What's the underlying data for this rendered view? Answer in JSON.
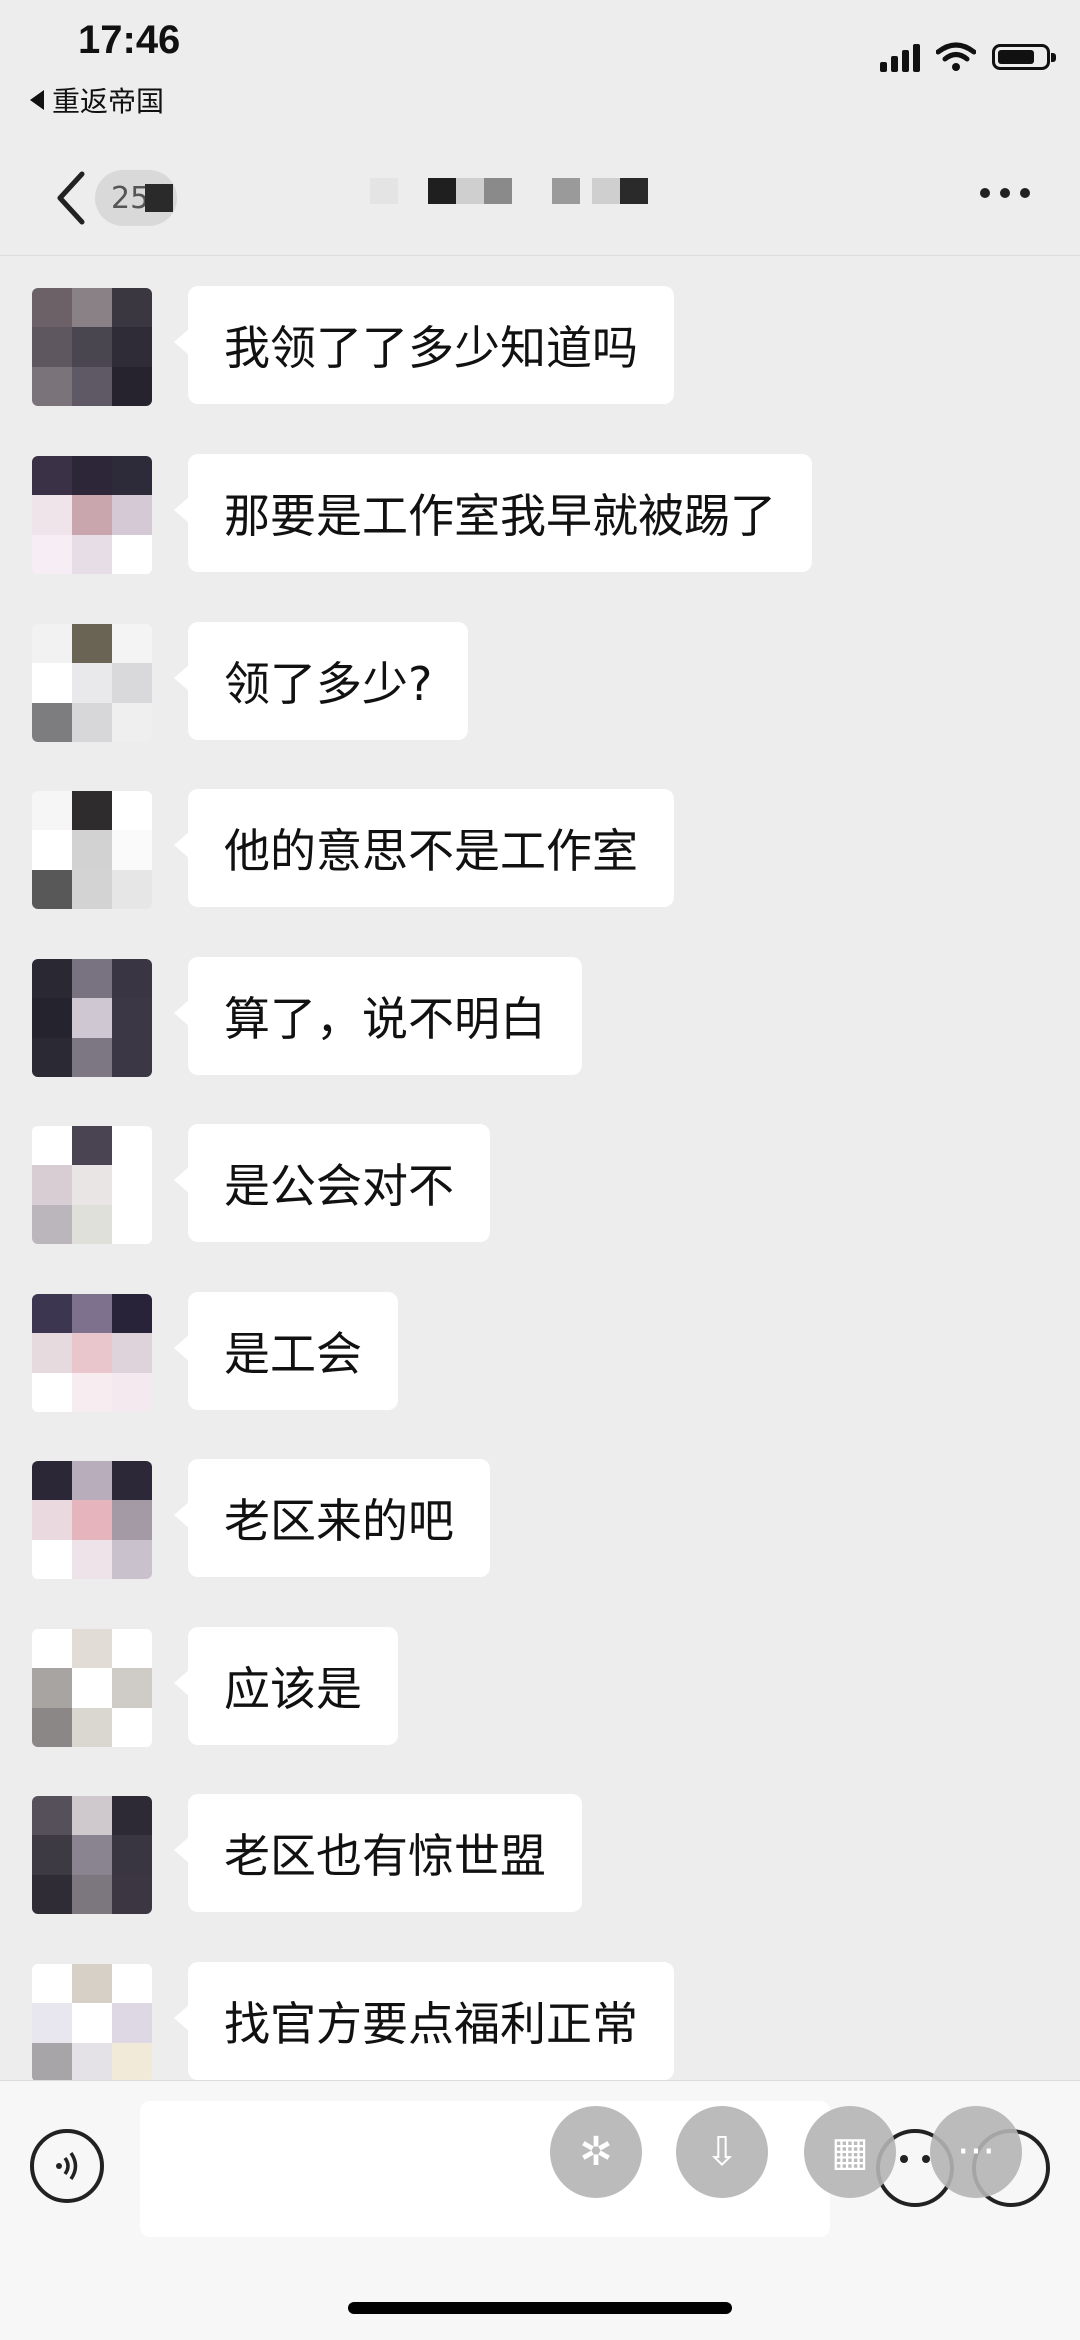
{
  "status_bar": {
    "time": "17:46",
    "back_app": "重返帝国"
  },
  "nav": {
    "unread_count": "25",
    "more_icon": "ellipsis-icon"
  },
  "messages": [
    {
      "text": "我领了了多少知道吗",
      "avatar_colors": [
        "#6b6166",
        "#8a8186",
        "#3a3740",
        "#5e5760",
        "#4a4650",
        "#2f2c37",
        "#7a747a",
        "#5f5965",
        "#26232e"
      ]
    },
    {
      "text": "那要是工作室我早就被踢了",
      "avatar_colors": [
        "#3b3147",
        "#2c2638",
        "#2d2a3a",
        "#efe4ea",
        "#c9a5ad",
        "#d6c9d6",
        "#f6eef4",
        "#e7dde6",
        "#ffffff"
      ]
    },
    {
      "text": "领了多少?",
      "avatar_colors": [
        "#f2f2f2",
        "#6a6455",
        "#f4f4f4",
        "#ffffff",
        "#e9e9eb",
        "#d9d9dc",
        "#7d7d80",
        "#d7d7d9",
        "#efefef"
      ]
    },
    {
      "text": "他的意思不是工作室",
      "avatar_colors": [
        "#f6f6f6",
        "#2e2c2c",
        "#ffffff",
        "#ffffff",
        "#d2d2d2",
        "#fafafa",
        "#585858",
        "#d3d3d3",
        "#e6e6e6"
      ]
    },
    {
      "text": "算了，说不明白",
      "avatar_colors": [
        "#2a2833",
        "#797381",
        "#3a3542",
        "#25232d",
        "#cfc8d2",
        "#3b3744",
        "#2b2934",
        "#7d7783",
        "#3c3745"
      ]
    },
    {
      "text": "是公会对不",
      "avatar_colors": [
        "#ffffff",
        "#4a4452",
        "#ffffff",
        "#d8cdd2",
        "#e9e5e5",
        "#ffffff",
        "#bab6bb",
        "#dfe0da",
        "#ffffff"
      ]
    },
    {
      "text": "是工会",
      "avatar_colors": [
        "#3d3651",
        "#7d718e",
        "#282339",
        "#e7dade",
        "#e8c6cb",
        "#ded3db",
        "#ffffff",
        "#f7edf1",
        "#f3e9ee"
      ]
    },
    {
      "text": "老区来的吧",
      "avatar_colors": [
        "#2b2736",
        "#b8aebb",
        "#2c2837",
        "#ead9de",
        "#e5b4bd",
        "#a39aa5",
        "#ffffff",
        "#efe3ea",
        "#c9c2cc"
      ]
    },
    {
      "text": "应该是",
      "avatar_colors": [
        "#ffffff",
        "#e1dcd6",
        "#ffffff",
        "#a8a4a2",
        "#ffffff",
        "#cfcbc6",
        "#8b8786",
        "#dad7d1",
        "#ffffff"
      ]
    },
    {
      "text": "老区也有惊世盟",
      "avatar_colors": [
        "#55505a",
        "#cfc9ce",
        "#2d2a35",
        "#3e3a44",
        "#8a8490",
        "#3a3641",
        "#2f2c35",
        "#7c767f",
        "#3b3641"
      ]
    },
    {
      "text": "找官方要点福利正常",
      "avatar_colors": [
        "#ffffff",
        "#d6d0c7",
        "#ffffff",
        "#e8e6ef",
        "#ffffff",
        "#ded8e5",
        "#a7a5a7",
        "#e4e2e6",
        "#f2ead8"
      ]
    }
  ],
  "input_bar": {
    "placeholder": "",
    "voice_icon": "voice-icon",
    "emoji_icon": "emoji-icon",
    "plus_icon": "plus-icon"
  }
}
